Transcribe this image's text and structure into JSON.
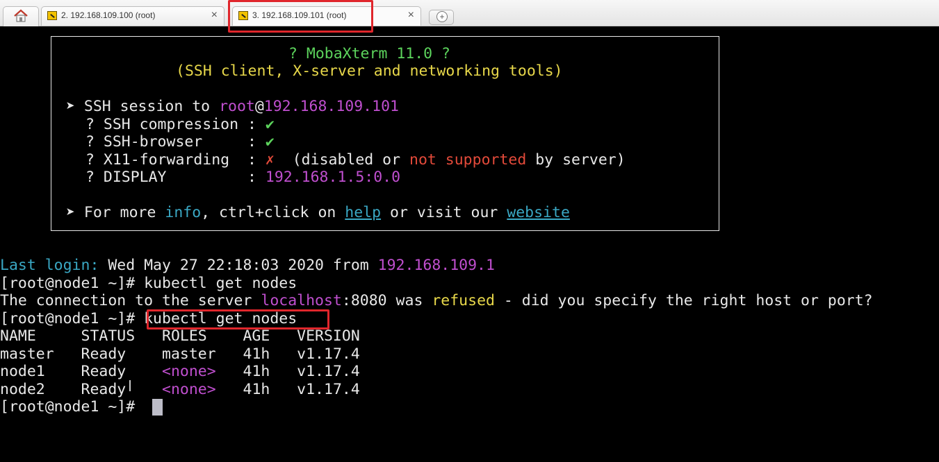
{
  "tabs": [
    {
      "label": "2. 192.168.109.100 (root)",
      "close": "×"
    },
    {
      "label": "3. 192.168.109.101 (root)",
      "close": "×"
    }
  ],
  "banner": {
    "title": "? MobaXterm 11.0 ?",
    "subtitle": "(SSH client, X-server and networking tools)",
    "session_prefix": "➤ SSH session to ",
    "user": "root",
    "at": "@",
    "host": "192.168.109.101",
    "opt1_label": "? SSH compression : ",
    "opt1_value": "✔",
    "opt2_label": "? SSH-browser     : ",
    "opt2_value": "✔",
    "opt3_label": "? X11-forwarding  : ",
    "opt3_value": "✗",
    "opt3_note_a": "  (disabled or ",
    "opt3_note_b": "not supported",
    "opt3_note_c": " by server)",
    "opt4_label": "? DISPLAY         : ",
    "opt4_value": "192.168.1.5:0.0",
    "more_a": "➤ For more ",
    "more_info": "info",
    "more_b": ", ctrl+click on ",
    "more_help": "help",
    "more_c": " or visit our ",
    "more_website": "website"
  },
  "terminal": {
    "last_login_label": "Last login:",
    "last_login_text": " Wed May 27 22:18:03 2020 from ",
    "last_login_ip": "192.168.109.1",
    "prompt": "[root@node1 ~]# ",
    "cmd1": "kubectl get nodes",
    "err_a": "The connection to the server ",
    "err_host": "localhost",
    "err_b": ":8080 was ",
    "err_refused": "refused",
    "err_c": " - did you specify the right host or port?",
    "cmd2": "kubectl get nodes",
    "table_header": "NAME     STATUS   ROLES    AGE   VERSION",
    "rows": [
      {
        "pre": "master   Ready    ",
        "role": "master",
        "post": "   41h   v1.17.4"
      },
      {
        "pre": "node1    Ready    ",
        "role": "<none>",
        "post": "   41h   v1.17.4"
      },
      {
        "pre": "node2    Ready    ",
        "role": "<none>",
        "post": "   41h   v1.17.4"
      }
    ],
    "final_prompt": "[root@node1 ~]# "
  }
}
